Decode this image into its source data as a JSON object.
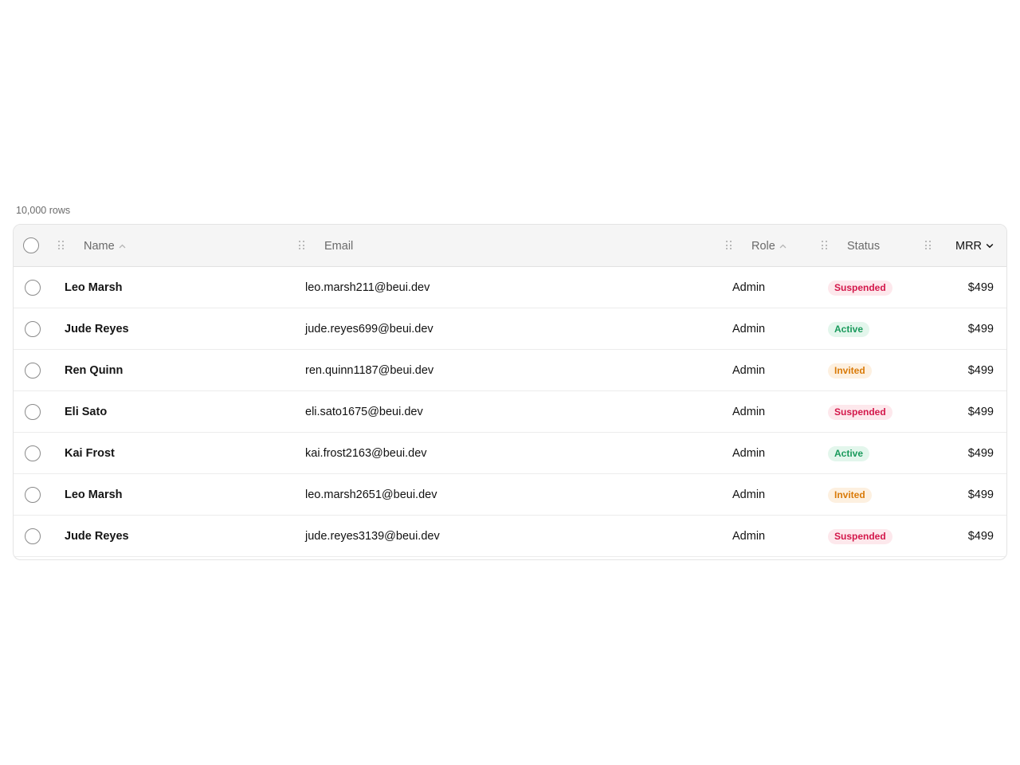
{
  "table_meta": {
    "row_count_label": "10,000 rows"
  },
  "columns": {
    "name": {
      "label": "Name",
      "sort": "asc",
      "sort_icon": "chevron-up-icon"
    },
    "email": {
      "label": "Email"
    },
    "role": {
      "label": "Role",
      "sort": "asc",
      "sort_icon": "chevron-up-icon"
    },
    "status": {
      "label": "Status"
    },
    "mrr": {
      "label": "MRR",
      "sort": "desc",
      "sort_icon": "chevron-down-icon",
      "active": true
    }
  },
  "rows": [
    {
      "name": "Leo Marsh",
      "email": "leo.marsh211@beui.dev",
      "role": "Admin",
      "status": "Suspended",
      "mrr": "$499"
    },
    {
      "name": "Jude Reyes",
      "email": "jude.reyes699@beui.dev",
      "role": "Admin",
      "status": "Active",
      "mrr": "$499"
    },
    {
      "name": "Ren Quinn",
      "email": "ren.quinn1187@beui.dev",
      "role": "Admin",
      "status": "Invited",
      "mrr": "$499"
    },
    {
      "name": "Eli Sato",
      "email": "eli.sato1675@beui.dev",
      "role": "Admin",
      "status": "Suspended",
      "mrr": "$499"
    },
    {
      "name": "Kai Frost",
      "email": "kai.frost2163@beui.dev",
      "role": "Admin",
      "status": "Active",
      "mrr": "$499"
    },
    {
      "name": "Leo Marsh",
      "email": "leo.marsh2651@beui.dev",
      "role": "Admin",
      "status": "Invited",
      "mrr": "$499"
    },
    {
      "name": "Jude Reyes",
      "email": "jude.reyes3139@beui.dev",
      "role": "Admin",
      "status": "Suspended",
      "mrr": "$499"
    }
  ],
  "colors": {
    "suspended": "#d3174a",
    "active": "#1a9a5c",
    "invited": "#d97a08"
  }
}
